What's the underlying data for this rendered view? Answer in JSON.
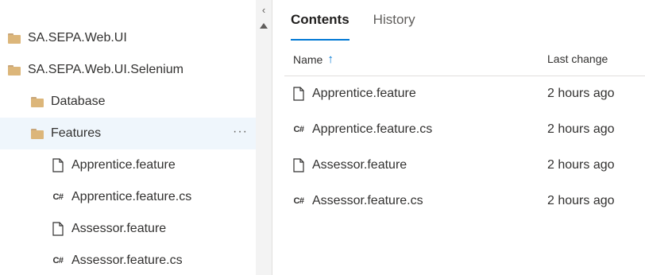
{
  "tree": {
    "items": [
      {
        "label": "SA.SEPA.Web.UI",
        "icon": "folder-icon"
      },
      {
        "label": "SA.SEPA.Web.UI.Selenium",
        "icon": "folder-icon"
      },
      {
        "label": "Database",
        "icon": "folder-icon"
      },
      {
        "label": "Features",
        "icon": "folder-icon",
        "selected": true,
        "more": "···"
      },
      {
        "label": "Apprentice.feature",
        "icon": "file-icon"
      },
      {
        "label": "Apprentice.feature.cs",
        "icon": "csharp-icon",
        "badge": "C#"
      },
      {
        "label": "Assessor.feature",
        "icon": "file-icon"
      },
      {
        "label": "Assessor.feature.cs",
        "icon": "csharp-icon",
        "badge": "C#"
      }
    ],
    "collapse_glyph": "‹"
  },
  "content": {
    "tabs": [
      {
        "label": "Contents",
        "active": true
      },
      {
        "label": "History",
        "active": false
      }
    ],
    "columns": {
      "name": "Name",
      "sort_glyph": "↑",
      "last_change": "Last change"
    },
    "files": [
      {
        "name": "Apprentice.feature",
        "icon": "file-icon",
        "last_change": "2 hours ago"
      },
      {
        "name": "Apprentice.feature.cs",
        "icon": "csharp-icon",
        "badge": "C#",
        "last_change": "2 hours ago"
      },
      {
        "name": "Assessor.feature",
        "icon": "file-icon",
        "last_change": "2 hours ago"
      },
      {
        "name": "Assessor.feature.cs",
        "icon": "csharp-icon",
        "badge": "C#",
        "last_change": "2 hours ago"
      }
    ]
  },
  "colors": {
    "accent": "#0078d4",
    "selected_row": "#eff6fc",
    "folder": "#dcb67a"
  }
}
